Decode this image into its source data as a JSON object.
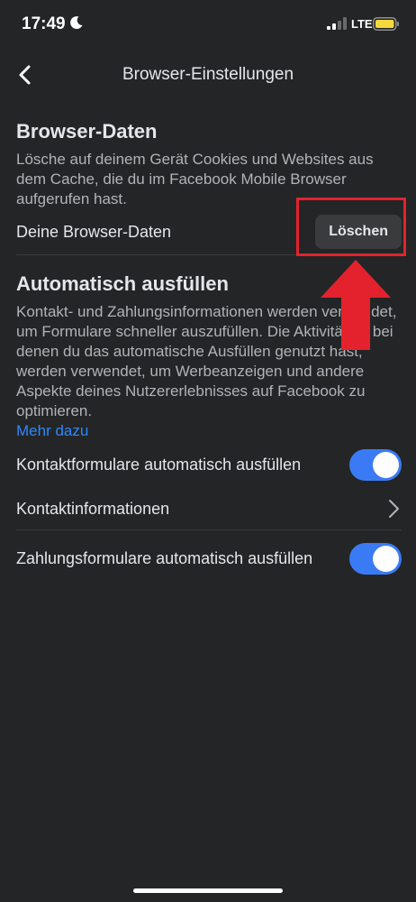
{
  "status_bar": {
    "time": "17:49",
    "network": "LTE",
    "icons": [
      "moon-icon",
      "signal-icon",
      "battery-icon"
    ],
    "battery_color": "#f5d83d"
  },
  "header": {
    "title": "Browser-Einstellungen",
    "back_icon": "back-chevron-icon"
  },
  "browser_data": {
    "title": "Browser-Daten",
    "description": "Lösche auf deinem Gerät Cookies und Websites aus dem Cache, die du im Facebook Mobile Browser aufgerufen hast.",
    "row_label": "Deine Browser-Daten",
    "button_label": "Löschen"
  },
  "autofill": {
    "title": "Automatisch ausfüllen",
    "description": "Kontakt- und Zahlungsinformationen werden verwendet, um Formulare schneller auszufüllen. Die Aktivitäten, bei denen du das automatische Ausfüllen genutzt hast, werden verwendet, um Werbeanzeigen und andere Aspekte deines Nutzererlebnisses auf Facebook zu optimieren.",
    "link_label": "Mehr dazu",
    "contact_forms_label": "Kontaktformulare automatisch ausfüllen",
    "contact_forms_enabled": true,
    "contact_info_label": "Kontaktinformationen",
    "payment_forms_label": "Zahlungsformulare automatisch ausfüllen",
    "payment_forms_enabled": true
  },
  "colors": {
    "background": "#242526",
    "toggle_on": "#3a7bf5",
    "link": "#2d88ff",
    "annotation_red": "#e3222e"
  }
}
